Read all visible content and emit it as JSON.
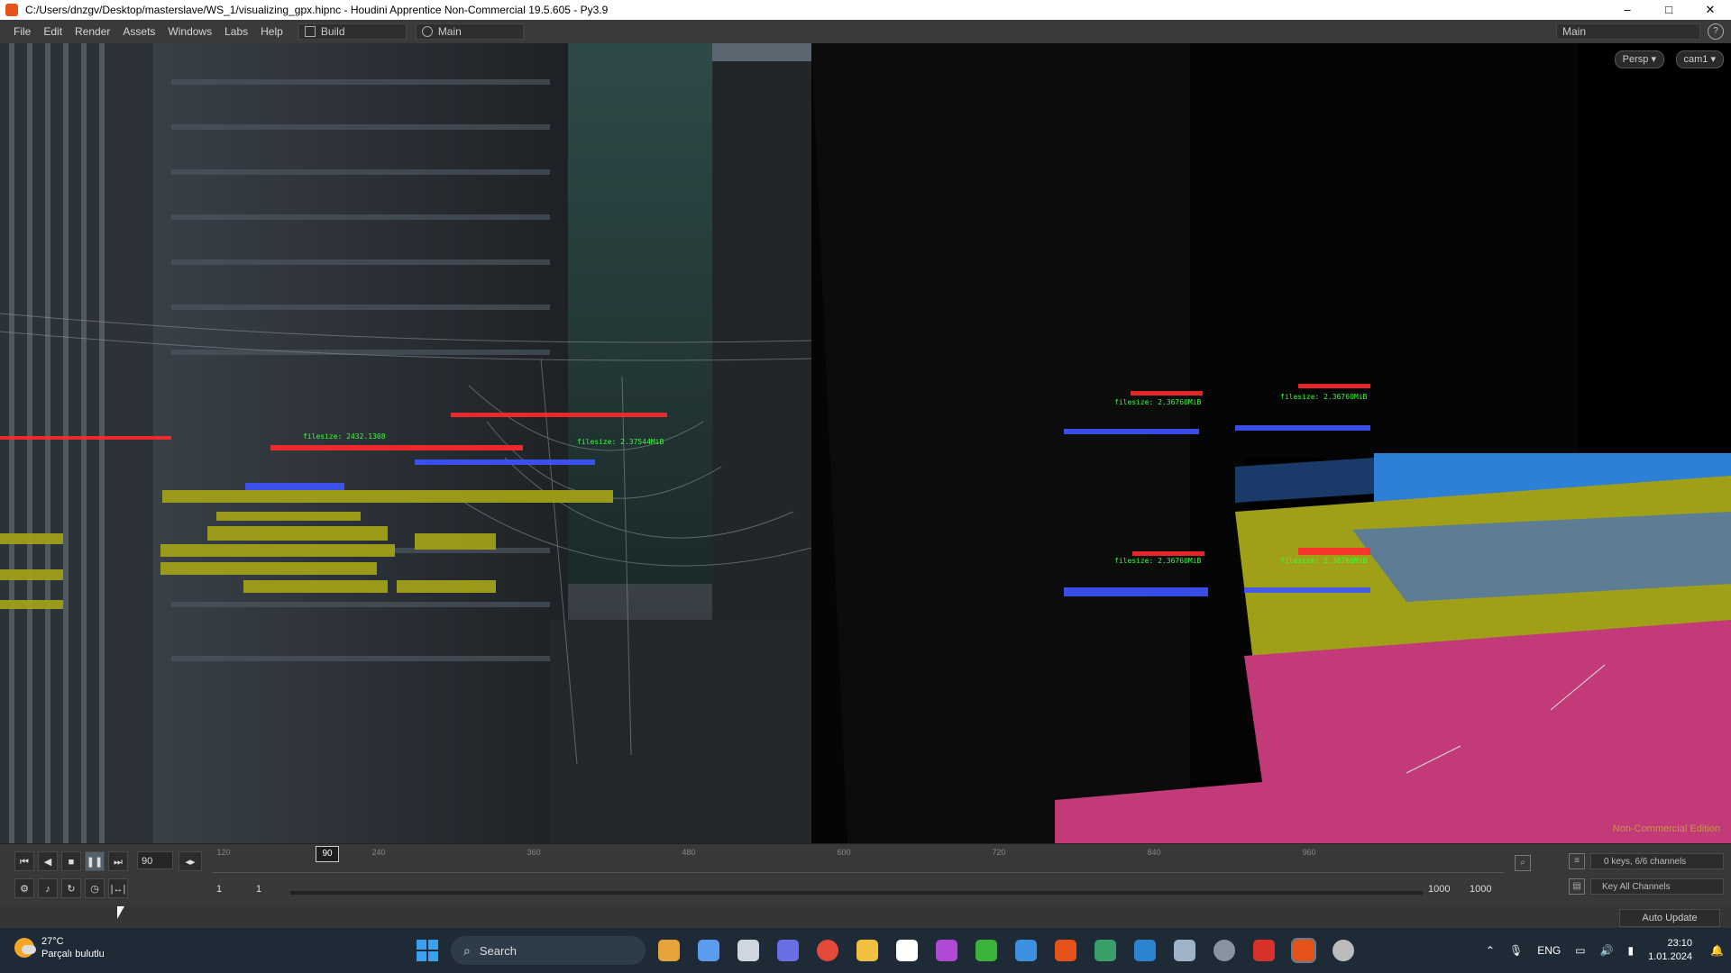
{
  "window": {
    "title": "C:/Users/dnzgv/Desktop/masterslave/WS_1/visualizing_gpx.hipnc - Houdini Apprentice Non-Commercial 19.5.605 - Py3.9",
    "controls": [
      "–",
      "□",
      "✕"
    ]
  },
  "menu": {
    "items": [
      "File",
      "Edit",
      "Render",
      "Assets",
      "Windows",
      "Labs",
      "Help"
    ],
    "desktop_build": "Build",
    "desktop_main": "Main",
    "right_desktop": "Main",
    "help_glyph": "?"
  },
  "viewport": {
    "persp_label": "Persp ▾",
    "cam_label": "cam1 ▾",
    "watermark": "Non-Commercial Edition",
    "annotations": [
      {
        "text": "filesize: 2.36760MiB",
        "cls": "g"
      },
      {
        "text": "filesize: 2.36760MiB",
        "cls": "g"
      },
      {
        "text": "filesize: 2.36760MiB",
        "cls": "g"
      },
      {
        "text": "filesize: 2.36760MiB",
        "cls": "g"
      },
      {
        "text": "filesize: 2432.1308",
        "cls": "g"
      },
      {
        "text": "filesize: 2.37544MiB",
        "cls": "g"
      }
    ]
  },
  "timeline": {
    "current_frame": "90",
    "playhead_label": "90",
    "ruler_labels": [
      "120",
      "240",
      "360",
      "480",
      "600",
      "720",
      "840",
      "960"
    ],
    "range_start": "1",
    "range_start2": "1",
    "range_end": "1000",
    "range_end2": "1000",
    "keys_info": "0 keys, 6/6 channels",
    "key_all": "Key All Channels"
  },
  "status": {
    "auto_update": "Auto Update"
  },
  "taskbar": {
    "weather_temp": "27°C",
    "weather_desc": "Parçalı bulutlu",
    "search_label": "Search",
    "lang": "ENG",
    "time": "23:10",
    "date": "1.01.2024"
  },
  "colors": {
    "houdini_orange": "#e5531a",
    "annotation_red": "#ff2a2a",
    "annotation_green": "#35ff35",
    "annotation_blue": "#3d55ff",
    "terrain_yellow": "#a0a018",
    "terrain_pink": "#c23b78"
  }
}
